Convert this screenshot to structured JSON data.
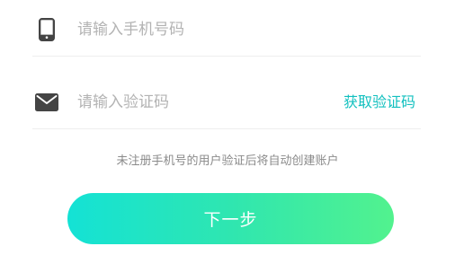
{
  "form": {
    "phone": {
      "icon": "phone-icon",
      "placeholder": "请输入手机号码",
      "value": ""
    },
    "code": {
      "icon": "mail-icon",
      "placeholder": "请输入验证码",
      "value": "",
      "get_code_label": "获取验证码"
    },
    "hint": "未注册手机号的用户验证后将自动创建账户",
    "next_label": "下一步"
  },
  "colors": {
    "accent": "#12c0bf",
    "button_gradient_start": "#14e2d5",
    "button_gradient_end": "#52f28e",
    "icon": "#444444",
    "placeholder": "#b3b3b3",
    "hint": "#8a8a8a",
    "divider": "#eeeeee"
  }
}
